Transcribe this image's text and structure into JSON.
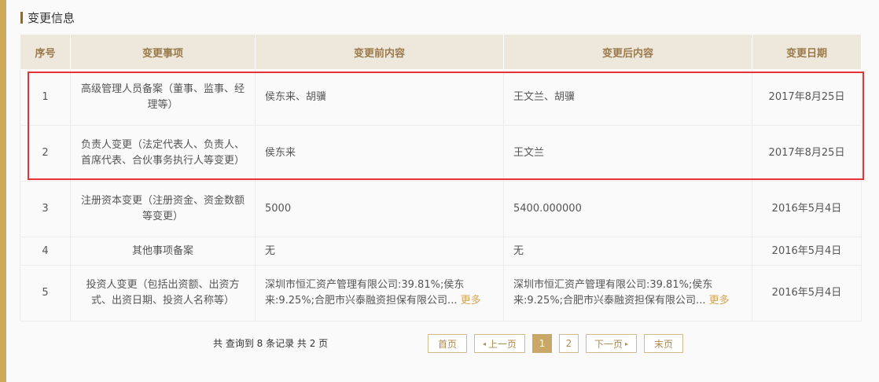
{
  "section": {
    "title": "变更信息"
  },
  "table": {
    "headers": [
      "序号",
      "变更事项",
      "变更前内容",
      "变更后内容",
      "变更日期"
    ],
    "rows": [
      {
        "no": "1",
        "item": "高级管理人员备案（董事、监事、经理等）",
        "before": "侯东来、胡骥",
        "after": "王文兰、胡骥",
        "date": "2017年8月25日"
      },
      {
        "no": "2",
        "item": "负责人变更（法定代表人、负责人、首席代表、合伙事务执行人等变更）",
        "before": "侯东来",
        "after": "王文兰",
        "date": "2017年8月25日"
      },
      {
        "no": "3",
        "item": "注册资本变更（注册资金、资金数额等变更）",
        "before": "5000",
        "after": "5400.000000",
        "date": "2016年5月4日"
      },
      {
        "no": "4",
        "item": "其他事项备案",
        "before": "无",
        "after": "无",
        "date": "2016年5月4日"
      },
      {
        "no": "5",
        "item": "投资人变更（包括出资额、出资方式、出资日期、投资人名称等）",
        "before": "深圳市恒汇资产管理有限公司:39.81%;侯东来:9.25%;合肥市兴泰融资担保有限公司...",
        "after": "深圳市恒汇资产管理有限公司:39.81%;侯东来:9.25%;合肥市兴泰融资担保有限公司...",
        "date": "2016年5月4日",
        "more": "更多"
      }
    ]
  },
  "pagination": {
    "summary": "共 查询到 8 条记录 共 2 页",
    "first": "首页",
    "prev": "上一页",
    "pages": [
      "1",
      "2"
    ],
    "current": "1",
    "next": "下一页",
    "last": "末页"
  },
  "colors": {
    "accent": "#d0a955",
    "header_bg": "#eee7db",
    "header_text": "#9a7a4a",
    "highlight": "#e8323a",
    "link": "#d9a24f"
  }
}
